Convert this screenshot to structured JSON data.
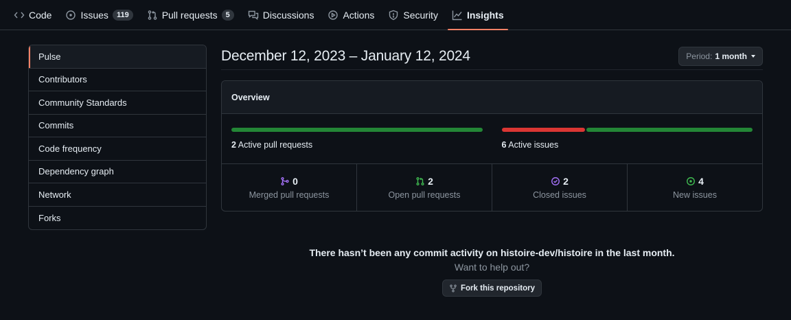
{
  "nav": {
    "items": [
      {
        "label": "Code",
        "icon": "code-icon"
      },
      {
        "label": "Issues",
        "icon": "issue-icon",
        "count": "119"
      },
      {
        "label": "Pull requests",
        "icon": "pull-request-icon",
        "count": "5"
      },
      {
        "label": "Discussions",
        "icon": "discussions-icon"
      },
      {
        "label": "Actions",
        "icon": "play-icon"
      },
      {
        "label": "Security",
        "icon": "shield-icon"
      },
      {
        "label": "Insights",
        "icon": "graph-icon",
        "selected": true
      }
    ]
  },
  "sidebar": {
    "items": [
      {
        "label": "Pulse",
        "selected": true
      },
      {
        "label": "Contributors"
      },
      {
        "label": "Community Standards"
      },
      {
        "label": "Commits"
      },
      {
        "label": "Code frequency"
      },
      {
        "label": "Dependency graph"
      },
      {
        "label": "Network"
      },
      {
        "label": "Forks"
      }
    ]
  },
  "main": {
    "date_range": "December 12, 2023 – January 12, 2024",
    "period_label": "Period:",
    "period_value": "1 month"
  },
  "overview": {
    "title": "Overview",
    "active_prs": {
      "count": "2",
      "label": "Active pull requests",
      "merged_fraction": 0,
      "open_fraction": 1
    },
    "active_issues": {
      "count": "6",
      "label": "Active issues",
      "closed_fraction": 0.333,
      "new_fraction": 0.667
    },
    "stats": [
      {
        "value": "0",
        "label": "Merged pull requests",
        "icon": "merged-icon",
        "color": "#a371f7"
      },
      {
        "value": "2",
        "label": "Open pull requests",
        "icon": "pull-request-icon",
        "color": "#3fb950"
      },
      {
        "value": "2",
        "label": "Closed issues",
        "icon": "closed-issue-icon",
        "color": "#a371f7"
      },
      {
        "value": "4",
        "label": "New issues",
        "icon": "issue-icon",
        "color": "#3fb950"
      }
    ]
  },
  "colors": {
    "green": "#238636",
    "red": "#da3633",
    "accent": "#f78166"
  },
  "empty_state": {
    "title": "There hasn’t been any commit activity on histoire-dev/histoire in the last month.",
    "subtitle": "Want to help out?",
    "button": "Fork this repository"
  }
}
